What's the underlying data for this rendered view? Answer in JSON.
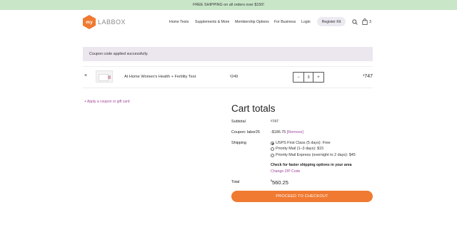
{
  "promo_bar": {
    "text": "FREE SHIPPING on all orders over $150!"
  },
  "header": {
    "logo": {
      "badge": "my",
      "brand": "LABBOX"
    },
    "nav": [
      "Home Tests",
      "Supplements & More",
      "Membership Options",
      "For Business",
      "Login"
    ],
    "register_kit": "Register Kit",
    "cart_count": "3",
    "icons": [
      "search-icon",
      "shopping-bag-icon"
    ]
  },
  "notice": {
    "text": "Coupon code applied successfully."
  },
  "cart": {
    "items": [
      {
        "remove": "×",
        "name": "At Home Women's Health + Fertility Test",
        "price_symbol": "$",
        "price": "249",
        "qty_minus": "−",
        "quantity": "3",
        "qty_plus": "+",
        "total_symbol": "$",
        "total": "747"
      }
    ],
    "coupon_link": "+ Apply a coupon or gift card"
  },
  "totals": {
    "title": "Cart totals",
    "subtotal_label": "Subtotal",
    "subtotal_symbol": "$",
    "subtotal_value": "747",
    "coupon_label": "Coupon: labor25",
    "coupon_value": "-$186.75",
    "coupon_remove": "[Remove]",
    "shipping_label": "Shipping",
    "shipping_options": [
      {
        "label": "USPS First Class (5 days): Free",
        "selected": true
      },
      {
        "label": "Priority Mail (1–3 days): $15",
        "selected": false
      },
      {
        "label": "Priority Mail Express (overnight to 2 days): $45",
        "selected": false
      }
    ],
    "shipping_note": "Check for faster shipping options in your area",
    "change_zip": "Change ZIP Code",
    "total_label": "Total",
    "total_symbol": "$",
    "total_value": "560.25",
    "checkout_button": "PROCEED TO CHECKOUT"
  },
  "colors": {
    "promo_bg": "#c9e6c9",
    "accent_orange": "#f07a31",
    "link_purple": "#a0489c",
    "notice_bg": "#ece6ef"
  }
}
